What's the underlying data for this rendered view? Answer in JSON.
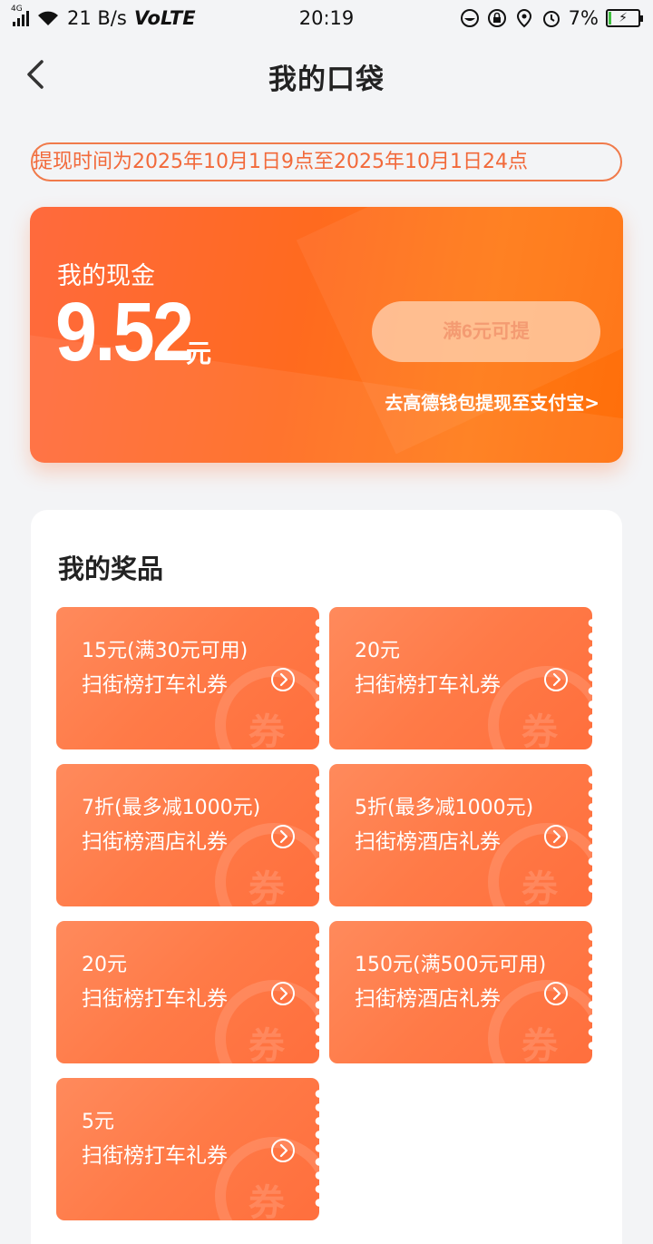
{
  "status_bar": {
    "network_type": "4G",
    "speed": "21 B/s",
    "volte": "VoLTE",
    "time": "20:19",
    "battery_percent": "7%",
    "battery_level": 0.07,
    "icons": [
      "signal-icon",
      "wifi-icon",
      "chat-icon",
      "lock-rotate-icon",
      "location-icon",
      "alarm-icon",
      "battery-icon"
    ]
  },
  "header": {
    "title": "我的口袋",
    "back_icon": "chevron-left-icon"
  },
  "notice": {
    "text": "提现时间为2025年10月1日9点至2025年10月1日24点"
  },
  "cash_card": {
    "label": "我的现金",
    "amount": "9.52",
    "unit": "元",
    "withdraw_button": "满6元可提",
    "alipay_link": "去高德钱包提现至支付宝>"
  },
  "prizes": {
    "title": "我的奖品",
    "watermark": "券",
    "items": [
      {
        "value": "15元(满30元可用)",
        "name": "扫街榜打车礼券"
      },
      {
        "value": "20元",
        "name": "扫街榜打车礼券"
      },
      {
        "value": "7折(最多减1000元)",
        "name": "扫街榜酒店礼券"
      },
      {
        "value": "5折(最多减1000元)",
        "name": "扫街榜酒店礼券"
      },
      {
        "value": "20元",
        "name": "扫街榜打车礼券"
      },
      {
        "value": "150元(满500元可用)",
        "name": "扫街榜酒店礼券"
      },
      {
        "value": "5元",
        "name": "扫街榜打车礼券"
      }
    ]
  },
  "colors": {
    "accent": "#ff6a1f",
    "notice_text": "#f2693a",
    "coupon": "#ff7a47",
    "background": "#f3f4f6"
  }
}
